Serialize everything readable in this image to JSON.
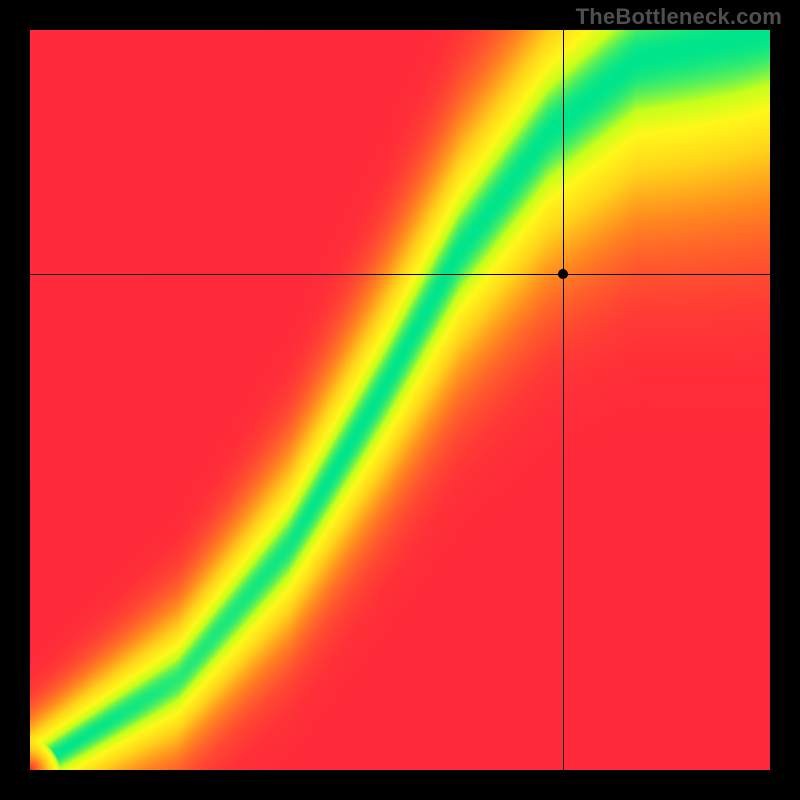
{
  "watermark": "TheBottleneck.com",
  "chart_data": {
    "type": "heatmap",
    "title": "",
    "xlabel": "",
    "ylabel": "",
    "xlim": [
      0,
      1
    ],
    "ylim": [
      0,
      1
    ],
    "grid": false,
    "legend": "none",
    "crosshair": {
      "x": 0.72,
      "y": 0.67
    },
    "marker": {
      "x": 0.72,
      "y": 0.67
    },
    "colormap": {
      "stops": [
        {
          "t": 0.0,
          "color": "#ff2a3a"
        },
        {
          "t": 0.35,
          "color": "#ff8a1f"
        },
        {
          "t": 0.6,
          "color": "#ffd21a"
        },
        {
          "t": 0.8,
          "color": "#fff81a"
        },
        {
          "t": 0.9,
          "color": "#c7ff1a"
        },
        {
          "t": 1.0,
          "color": "#00e58c"
        }
      ]
    },
    "ridge": {
      "description": "score≈1 along a curved ridge y=f(x); score falls with distance from ridge; extra damping near origin and toward bottom-right",
      "control_points": [
        {
          "x": 0.0,
          "y": 0.0
        },
        {
          "x": 0.2,
          "y": 0.12
        },
        {
          "x": 0.35,
          "y": 0.3
        },
        {
          "x": 0.48,
          "y": 0.52
        },
        {
          "x": 0.58,
          "y": 0.7
        },
        {
          "x": 0.7,
          "y": 0.86
        },
        {
          "x": 0.82,
          "y": 0.96
        },
        {
          "x": 1.0,
          "y": 1.0
        }
      ],
      "sigma_base": 0.045,
      "sigma_growth": 0.13
    }
  }
}
